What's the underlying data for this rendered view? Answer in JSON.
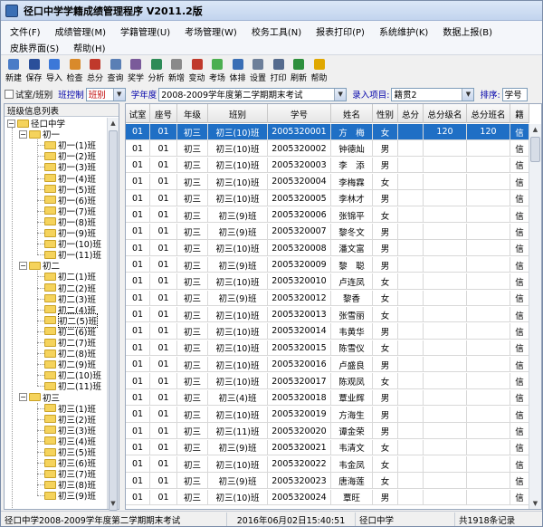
{
  "window": {
    "title": "径口中学学籍成绩管理程序 V2011.2版"
  },
  "menu": {
    "row1": [
      "文件(F)",
      "成绩管理(M)",
      "学籍管理(U)",
      "考场管理(W)",
      "校务工具(N)",
      "报表打印(P)",
      "系统维护(K)",
      "数据上报(B)"
    ],
    "row2": [
      "皮肤界面(S)",
      "帮助(H)"
    ]
  },
  "toolbar": [
    {
      "label": "新建",
      "icon": "new-icon",
      "color": "#4a7cc7"
    },
    {
      "label": "保存",
      "icon": "save-icon",
      "color": "#2a4f9a"
    },
    {
      "label": "导入",
      "icon": "import-icon",
      "color": "#3c78d8"
    },
    {
      "label": "检查",
      "icon": "check-icon",
      "color": "#d98a2b"
    },
    {
      "label": "总分",
      "icon": "sum-icon",
      "color": "#c0392b"
    },
    {
      "label": "查询",
      "icon": "query-icon",
      "color": "#5a7fb5"
    },
    {
      "label": "奖学",
      "icon": "award-icon",
      "color": "#7a5a9a"
    },
    {
      "label": "分析",
      "icon": "analysis-icon",
      "color": "#2e8b57"
    },
    {
      "label": "新增",
      "icon": "add-icon",
      "color": "#8a8a8a"
    },
    {
      "label": "变动",
      "icon": "change-icon",
      "color": "#c0392b"
    },
    {
      "label": "考场",
      "icon": "exam-room-icon",
      "color": "#4caf50"
    },
    {
      "label": "体排",
      "icon": "pe-rank-icon",
      "color": "#3a6fb5"
    },
    {
      "label": "设置",
      "icon": "settings-icon",
      "color": "#6d7f99"
    },
    {
      "label": "打印",
      "icon": "print-icon",
      "color": "#556b8d"
    },
    {
      "label": "刷新",
      "icon": "refresh-icon",
      "color": "#2d8f3c"
    },
    {
      "label": "帮助",
      "icon": "help-icon",
      "color": "#e0a800"
    }
  ],
  "filters": {
    "exam_class_checkbox": "试室/班别",
    "class_control_label": "班控制",
    "class_control_value": "班别",
    "year_label": "学年度",
    "year_value": "2008-2009学年度第二学期期末考试",
    "entry_label": "录入项目:",
    "entry_value": "籍贯2",
    "sort_label": "排序:",
    "sort_value": "学号"
  },
  "tree": {
    "title": "班级信息列表",
    "root": "径口中学",
    "grades": [
      {
        "name": "初一",
        "classes": [
          "初一(1)班",
          "初一(2)班",
          "初一(3)班",
          "初一(4)班",
          "初一(5)班",
          "初一(6)班",
          "初一(7)班",
          "初一(8)班",
          "初一(9)班",
          "初一(10)班",
          "初一(11)班"
        ]
      },
      {
        "name": "初二",
        "classes": [
          "初二(1)班",
          "初二(2)班",
          "初二(3)班",
          "初二(4)班",
          "初二(5)班",
          "初二(6)班",
          "初二(7)班",
          "初二(8)班",
          "初二(9)班",
          "初二(10)班",
          "初二(11)班"
        ]
      },
      {
        "name": "初三",
        "classes": [
          "初三(1)班",
          "初三(2)班",
          "初三(3)班",
          "初三(4)班",
          "初三(5)班",
          "初三(6)班",
          "初三(7)班",
          "初三(8)班",
          "初三(9)班"
        ]
      }
    ],
    "selected": "初二(5)班"
  },
  "grid": {
    "columns": [
      "试室",
      "座号",
      "年级",
      "班别",
      "学号",
      "姓名",
      "性别",
      "总分",
      "总分级名",
      "总分班名",
      "籍"
    ],
    "rows": [
      [
        "01",
        "01",
        "初三",
        "初三(10)班",
        "2005320001",
        "方　梅",
        "女",
        "",
        "120",
        "120",
        "信"
      ],
      [
        "01",
        "01",
        "初三",
        "初三(10)班",
        "2005320002",
        "钟德灿",
        "男",
        "",
        "",
        "",
        "信"
      ],
      [
        "01",
        "01",
        "初三",
        "初三(10)班",
        "2005320003",
        "李　添",
        "男",
        "",
        "",
        "",
        "信"
      ],
      [
        "01",
        "01",
        "初三",
        "初三(10)班",
        "2005320004",
        "李梅霖",
        "女",
        "",
        "",
        "",
        "信"
      ],
      [
        "01",
        "01",
        "初三",
        "初三(10)班",
        "2005320005",
        "李林才",
        "男",
        "",
        "",
        "",
        "信"
      ],
      [
        "01",
        "01",
        "初三",
        "初三(9)班",
        "2005320006",
        "张锦平",
        "女",
        "",
        "",
        "",
        "信"
      ],
      [
        "01",
        "01",
        "初三",
        "初三(9)班",
        "2005320007",
        "黎冬文",
        "男",
        "",
        "",
        "",
        "信"
      ],
      [
        "01",
        "01",
        "初三",
        "初三(10)班",
        "2005320008",
        "潘文富",
        "男",
        "",
        "",
        "",
        "信"
      ],
      [
        "01",
        "01",
        "初三",
        "初三(9)班",
        "2005320009",
        "黎　聪",
        "男",
        "",
        "",
        "",
        "信"
      ],
      [
        "01",
        "01",
        "初三",
        "初三(10)班",
        "2005320010",
        "卢连凤",
        "女",
        "",
        "",
        "",
        "信"
      ],
      [
        "01",
        "01",
        "初三",
        "初三(9)班",
        "2005320012",
        "黎香",
        "女",
        "",
        "",
        "",
        "信"
      ],
      [
        "01",
        "01",
        "初三",
        "初三(10)班",
        "2005320013",
        "张雪丽",
        "女",
        "",
        "",
        "",
        "信"
      ],
      [
        "01",
        "01",
        "初三",
        "初三(10)班",
        "2005320014",
        "韦黄华",
        "男",
        "",
        "",
        "",
        "信"
      ],
      [
        "01",
        "01",
        "初三",
        "初三(10)班",
        "2005320015",
        "陈雪仪",
        "女",
        "",
        "",
        "",
        "信"
      ],
      [
        "01",
        "01",
        "初三",
        "初三(10)班",
        "2005320016",
        "卢盛良",
        "男",
        "",
        "",
        "",
        "信"
      ],
      [
        "01",
        "01",
        "初三",
        "初三(10)班",
        "2005320017",
        "陈观凤",
        "女",
        "",
        "",
        "",
        "信"
      ],
      [
        "01",
        "01",
        "初三",
        "初三(4)班",
        "2005320018",
        "覃业辉",
        "男",
        "",
        "",
        "",
        "信"
      ],
      [
        "01",
        "01",
        "初三",
        "初三(10)班",
        "2005320019",
        "方海生",
        "男",
        "",
        "",
        "",
        "信"
      ],
      [
        "01",
        "01",
        "初三",
        "初三(11)班",
        "2005320020",
        "谭金荣",
        "男",
        "",
        "",
        "",
        "信"
      ],
      [
        "01",
        "01",
        "初三",
        "初三(9)班",
        "2005320021",
        "韦清文",
        "女",
        "",
        "",
        "",
        "信"
      ],
      [
        "01",
        "01",
        "初三",
        "初三(10)班",
        "2005320022",
        "韦金凤",
        "女",
        "",
        "",
        "",
        "信"
      ],
      [
        "01",
        "01",
        "初三",
        "初三(9)班",
        "2005320023",
        "唐海莲",
        "女",
        "",
        "",
        "",
        "信"
      ],
      [
        "01",
        "01",
        "初三",
        "初三(10)班",
        "2005320024",
        "覃旺",
        "男",
        "",
        "",
        "",
        "信"
      ]
    ],
    "selected_row": 0
  },
  "status": {
    "exam": "径口中学2008-2009学年度第二学期期末考试",
    "datetime": "2016年06月02日15:40:51",
    "school": "径口中学",
    "extra": "共1918条记录"
  },
  "colors": {
    "selection": "#1f6fc5",
    "label_blue": "#0000aa",
    "value_red": "#c00000"
  }
}
